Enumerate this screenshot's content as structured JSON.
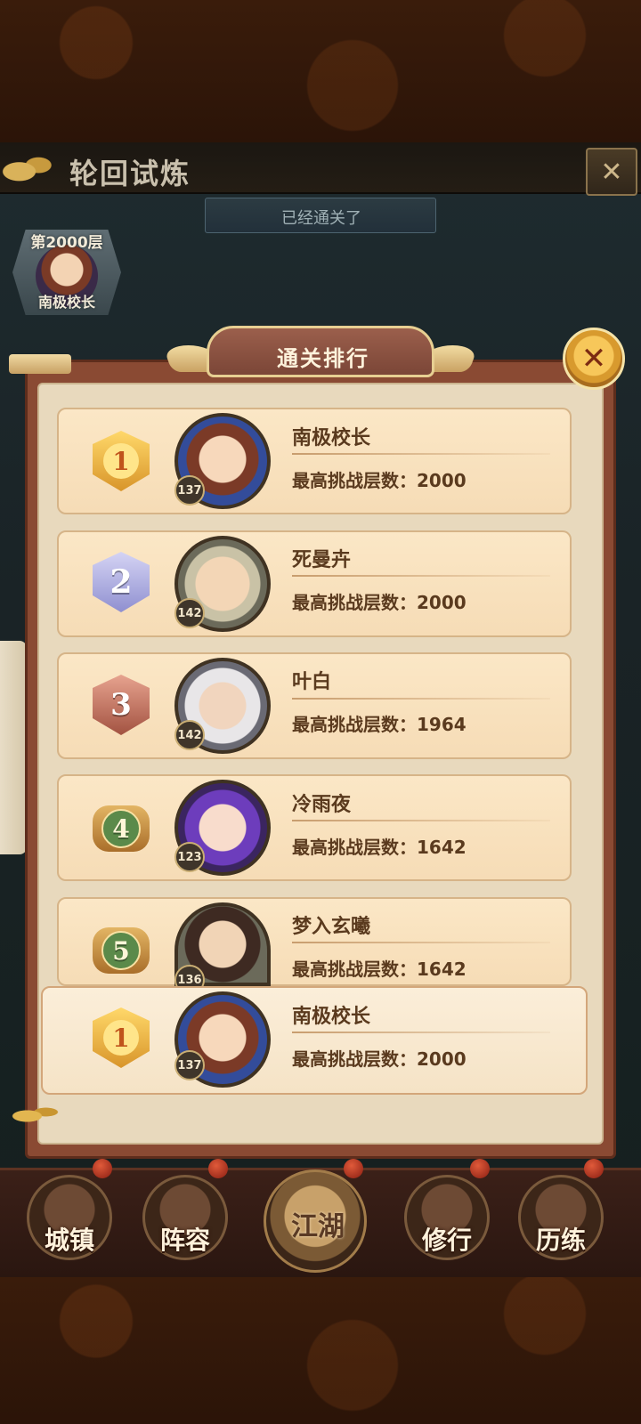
{
  "header": {
    "title": "轮回试炼",
    "subtitle": "已经通关了"
  },
  "floor": {
    "label": "第2000层",
    "name": "南极校长"
  },
  "panel": {
    "title": "通关排行",
    "score_label": "最高挑战层数："
  },
  "ranking": [
    {
      "rank": "1",
      "name": "南极校长",
      "level": "137",
      "score": "2000"
    },
    {
      "rank": "2",
      "name": "死曼卉",
      "level": "142",
      "score": "2000"
    },
    {
      "rank": "3",
      "name": "叶白",
      "level": "142",
      "score": "1964"
    },
    {
      "rank": "4",
      "name": "冷雨夜",
      "level": "123",
      "score": "1642"
    },
    {
      "rank": "5",
      "name": "梦入玄曦",
      "level": "136",
      "score": "1642"
    }
  ],
  "mine": {
    "rank": "1",
    "name": "南极校长",
    "level": "137",
    "score": "2000"
  },
  "nav": {
    "items": [
      "城镇",
      "阵容",
      "江湖",
      "修行",
      "历练"
    ]
  }
}
